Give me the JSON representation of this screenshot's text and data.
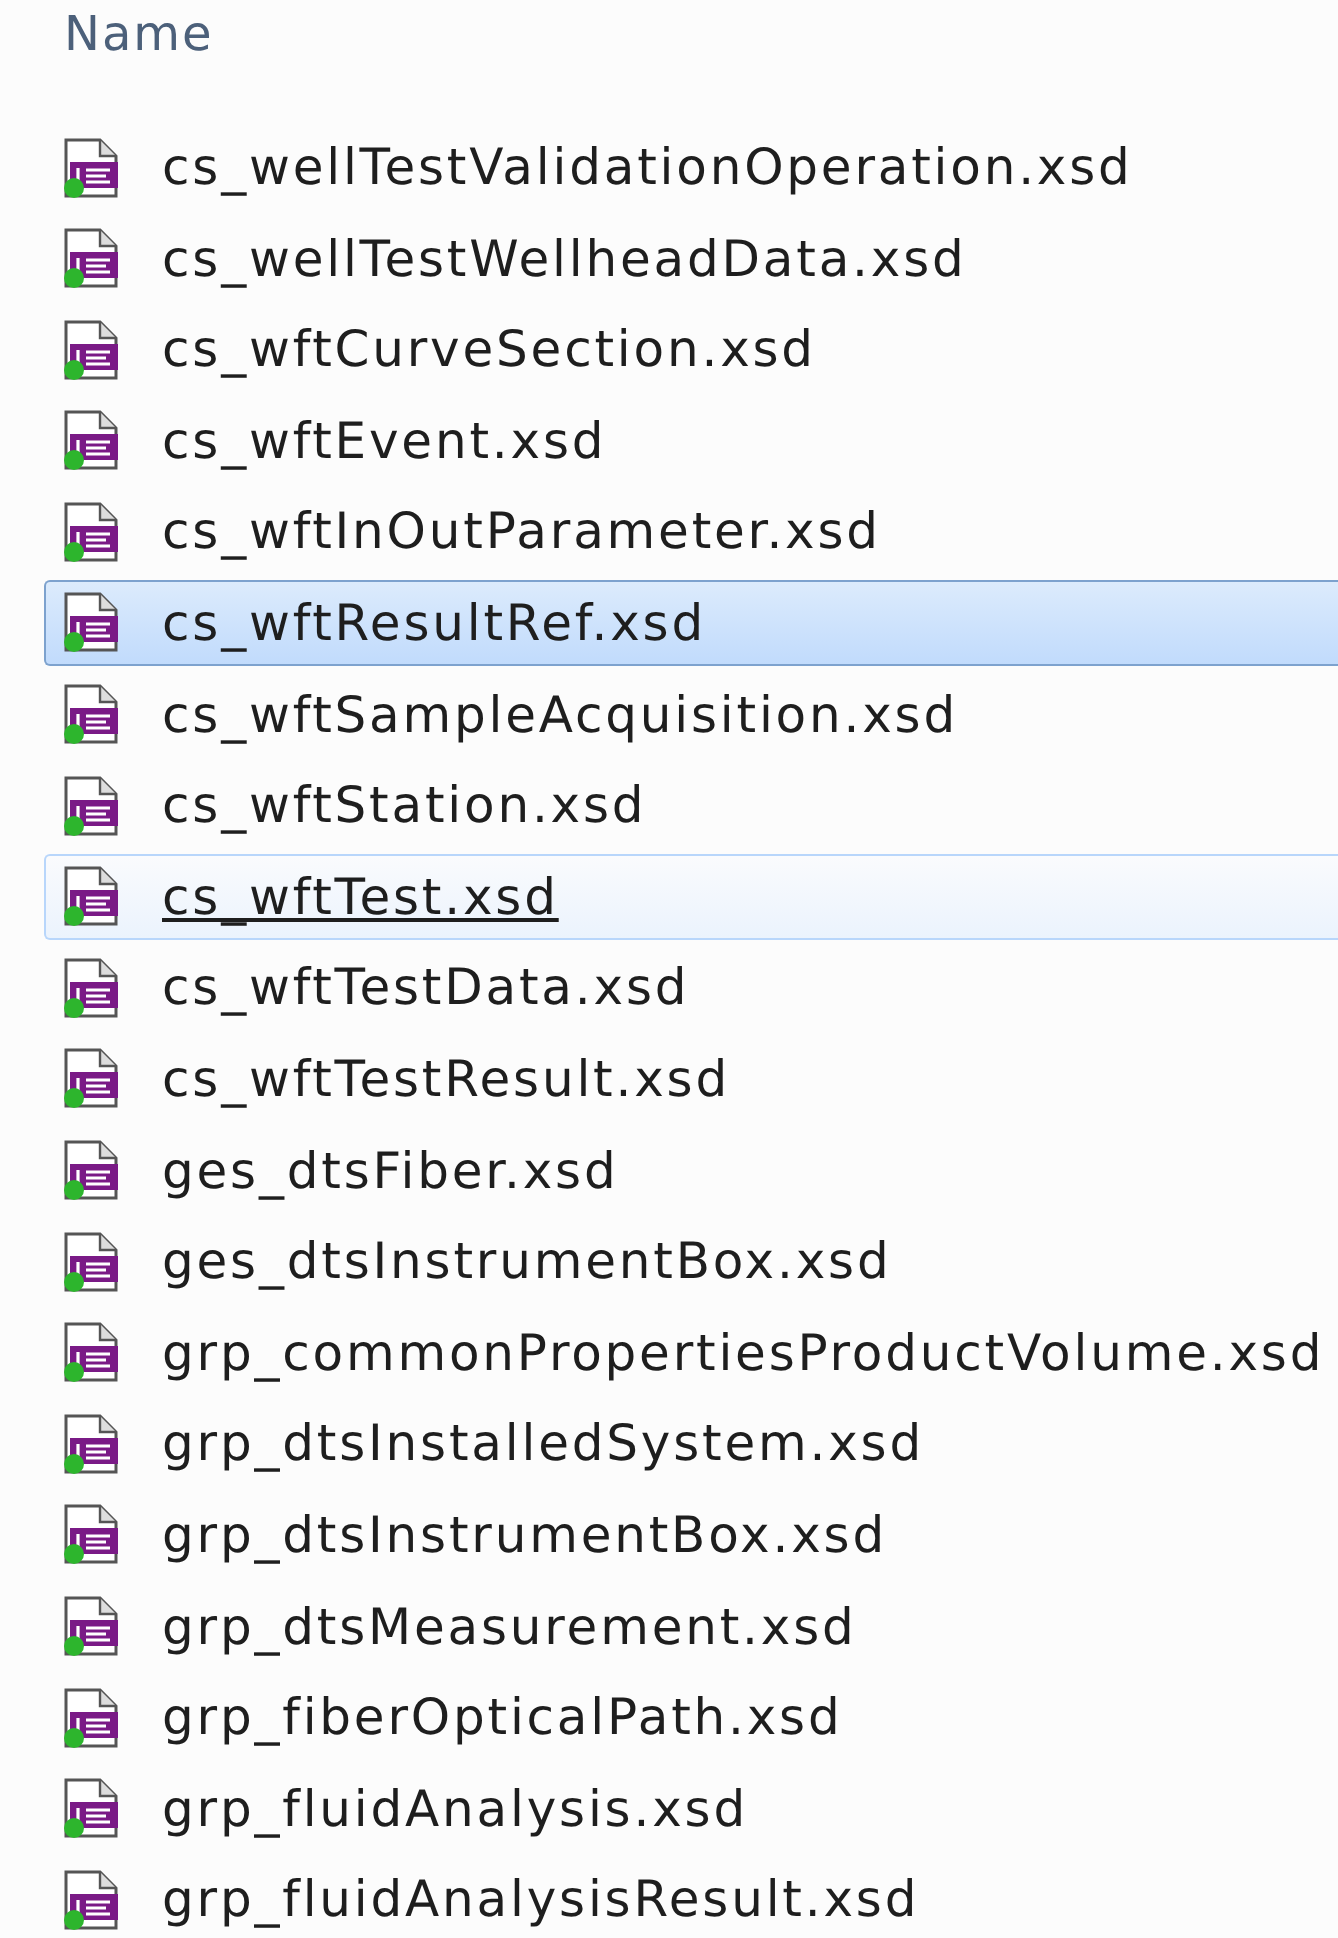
{
  "header": {
    "column": "Name"
  },
  "files": [
    {
      "name": "cs_wellTestValidationOperation.xsd",
      "selected": false,
      "hovered": false
    },
    {
      "name": "cs_wellTestWellheadData.xsd",
      "selected": false,
      "hovered": false
    },
    {
      "name": "cs_wftCurveSection.xsd",
      "selected": false,
      "hovered": false
    },
    {
      "name": "cs_wftEvent.xsd",
      "selected": false,
      "hovered": false
    },
    {
      "name": "cs_wftInOutParameter.xsd",
      "selected": false,
      "hovered": false
    },
    {
      "name": "cs_wftResultRef.xsd",
      "selected": true,
      "hovered": false
    },
    {
      "name": "cs_wftSampleAcquisition.xsd",
      "selected": false,
      "hovered": false
    },
    {
      "name": "cs_wftStation.xsd",
      "selected": false,
      "hovered": false
    },
    {
      "name": "cs_wftTest.xsd",
      "selected": false,
      "hovered": true
    },
    {
      "name": "cs_wftTestData.xsd",
      "selected": false,
      "hovered": false
    },
    {
      "name": "cs_wftTestResult.xsd",
      "selected": false,
      "hovered": false
    },
    {
      "name": "ges_dtsFiber.xsd",
      "selected": false,
      "hovered": false
    },
    {
      "name": "ges_dtsInstrumentBox.xsd",
      "selected": false,
      "hovered": false
    },
    {
      "name": "grp_commonPropertiesProductVolume.xsd",
      "selected": false,
      "hovered": false
    },
    {
      "name": "grp_dtsInstalledSystem.xsd",
      "selected": false,
      "hovered": false
    },
    {
      "name": "grp_dtsInstrumentBox.xsd",
      "selected": false,
      "hovered": false
    },
    {
      "name": "grp_dtsMeasurement.xsd",
      "selected": false,
      "hovered": false
    },
    {
      "name": "grp_fiberOpticalPath.xsd",
      "selected": false,
      "hovered": false
    },
    {
      "name": "grp_fluidAnalysis.xsd",
      "selected": false,
      "hovered": false
    },
    {
      "name": "grp_fluidAnalysisResult.xsd",
      "selected": false,
      "hovered": false
    }
  ]
}
